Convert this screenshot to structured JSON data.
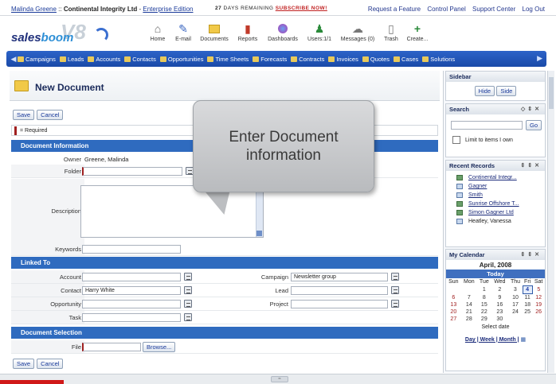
{
  "topbar": {
    "user": "Malinda Greene",
    "separator": " :: ",
    "company": "Continental Integrity Ltd",
    "dash": " - ",
    "edition": "Enterprise Edition",
    "days_num": "27",
    "days_text": " DAYS REMAINING ",
    "subscribe": "SUBSCRIBE NOW!",
    "links": [
      "Request a Feature",
      "Control Panel",
      "Support Center",
      "Log Out"
    ]
  },
  "header": {
    "logo_text_a": "sales",
    "logo_text_b": "boom",
    "logo_v8": "V8",
    "icons": [
      {
        "label": "Home",
        "icon": "home-icon"
      },
      {
        "label": "E-mail",
        "icon": "email-icon"
      },
      {
        "label": "Documents",
        "icon": "documents-icon"
      },
      {
        "label": "Reports",
        "icon": "reports-icon"
      },
      {
        "label": "Dashboards",
        "icon": "dashboards-icon"
      },
      {
        "label": "Users:1/1",
        "icon": "users-icon"
      },
      {
        "label": "Messages (0)",
        "icon": "messages-icon"
      },
      {
        "label": "Trash",
        "icon": "trash-icon"
      },
      {
        "label": "Create...",
        "icon": "create-icon"
      }
    ]
  },
  "nav": {
    "items": [
      "Campaigns",
      "Leads",
      "Accounts",
      "Contacts",
      "Opportunities",
      "Time Sheets",
      "Forecasts",
      "Contracts",
      "Invoices",
      "Quotes",
      "Cases",
      "Solutions"
    ]
  },
  "page": {
    "title": "New Document",
    "save": "Save",
    "cancel": "Cancel",
    "required": "= Required"
  },
  "doc_info": {
    "heading": "Document Information",
    "owner_label": "Owner",
    "owner_value": "Greene, Malinda",
    "folder_label": "Folder",
    "folder_value": "",
    "description_label": "Description",
    "keywords_label": "Keywords",
    "keywords_value": ""
  },
  "linked_to": {
    "heading": "Linked To",
    "account_label": "Account",
    "account_value": "",
    "campaign_label": "Campaign",
    "campaign_value": "Newsletter group",
    "contact_label": "Contact",
    "contact_value": "Harry White",
    "lead_label": "Lead",
    "lead_value": "",
    "opportunity_label": "Opportunity",
    "opportunity_value": "",
    "project_label": "Project",
    "project_value": "",
    "task_label": "Task",
    "task_value": ""
  },
  "doc_selection": {
    "heading": "Document Selection",
    "file_label": "File",
    "browse": "Browse..."
  },
  "callout": {
    "line1": "Enter Document",
    "line2": "information"
  },
  "sidebar": {
    "title": "Sidebar",
    "hide": "Hide",
    "side": "Side",
    "search_title": "Search",
    "search_go": "Go",
    "limit_label": "Limit to items I own",
    "recent_title": "Recent Records",
    "recent": [
      {
        "name": "Continental Integr...",
        "link": true
      },
      {
        "name": "Gagner",
        "link": true
      },
      {
        "name": "Smith",
        "link": true
      },
      {
        "name": "Sunrise Offshore T...",
        "link": true
      },
      {
        "name": "Simon Gagner Ltd",
        "link": true
      },
      {
        "name": "Heatley, Vanessa",
        "link": false
      }
    ],
    "calendar_title": "My Calendar",
    "month": "April, 2008",
    "today_label": "Today",
    "weekdays": [
      "Sun",
      "Mon",
      "Tue",
      "Wed",
      "Thu",
      "Fri",
      "Sat"
    ],
    "weeks": [
      [
        "",
        "",
        "1",
        "2",
        "3",
        "4",
        "5"
      ],
      [
        "6",
        "7",
        "8",
        "9",
        "10",
        "11",
        "12"
      ],
      [
        "13",
        "14",
        "15",
        "16",
        "17",
        "18",
        "19"
      ],
      [
        "20",
        "21",
        "22",
        "23",
        "24",
        "25",
        "26"
      ],
      [
        "27",
        "28",
        "29",
        "30",
        "",
        "",
        ""
      ]
    ],
    "today_day": "4",
    "select_date": "Select date",
    "views": "Day | Week | Month |"
  }
}
